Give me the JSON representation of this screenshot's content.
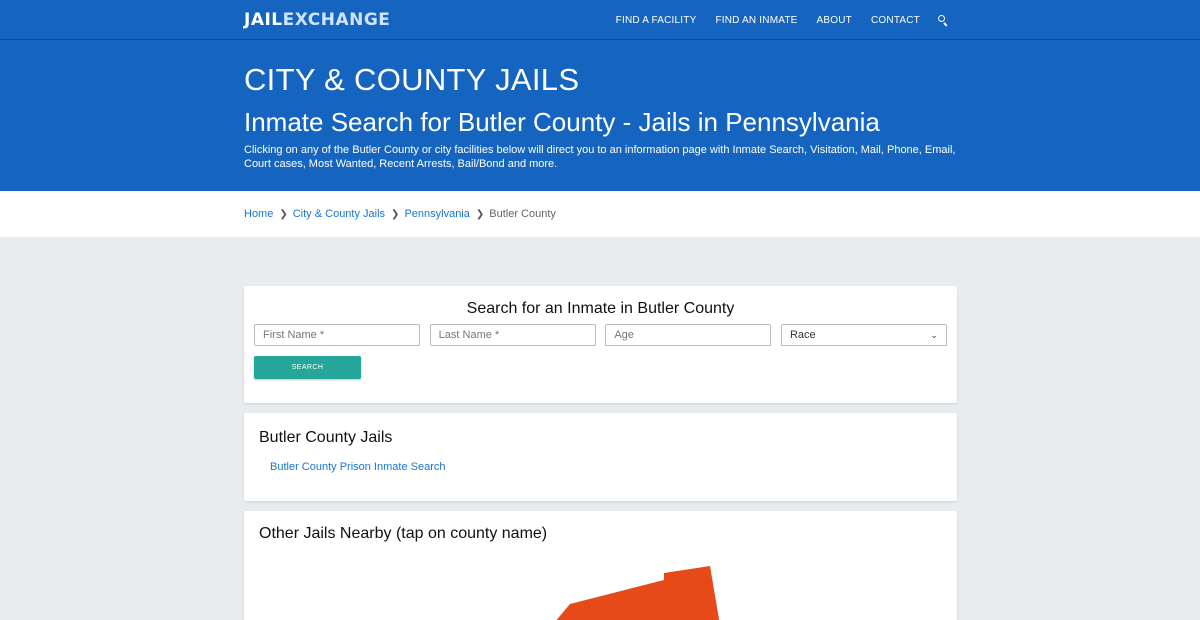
{
  "header": {
    "logo_jail": "JAIL",
    "logo_exchange": "EXCHANGE",
    "nav": [
      "FIND A FACILITY",
      "FIND AN INMATE",
      "ABOUT",
      "CONTACT"
    ],
    "search_icon": "search-icon"
  },
  "hero": {
    "title": "CITY & COUNTY JAILS",
    "subtitle": "Inmate Search for Butler County - Jails in Pennsylvania",
    "description": "Clicking on any of the Butler County or city facilities below will direct you to an information page with Inmate Search, Visitation, Mail, Phone, Email, Court cases, Most Wanted, Recent Arrests, Bail/Bond and more."
  },
  "breadcrumb": {
    "home": "Home",
    "level1": "City & County Jails",
    "level2": "Pennsylvania",
    "current": "Butler County"
  },
  "search_form": {
    "title": "Search for an Inmate in Butler County",
    "first_name_placeholder": "First Name *",
    "last_name_placeholder": "Last Name *",
    "age_placeholder": "Age",
    "race_selected": "Race",
    "button_label": "SEARCH"
  },
  "jails": {
    "heading": "Butler County Jails",
    "items": [
      "Butler County Prison Inmate Search"
    ]
  },
  "nearby": {
    "heading": "Other Jails Nearby (tap on county name)"
  },
  "colors": {
    "primary": "#1565c0",
    "accent_button": "#26a69a",
    "link": "#1976d2",
    "map_county": "#e64a19"
  }
}
